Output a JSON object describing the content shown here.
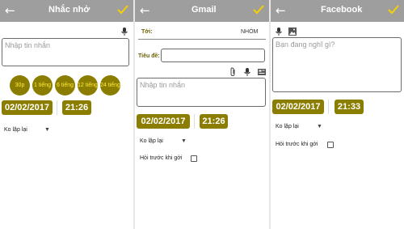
{
  "colors": {
    "appbar": "#9e9e9e",
    "accent": "#8b7d00",
    "chip_text": "#ffeb3b",
    "check": "#f5d000"
  },
  "reminder": {
    "title": "Nhắc nhở",
    "message_placeholder": "Nhập tin nhắn",
    "chips": [
      "30p",
      "1 tiếng",
      "6 tiếng",
      "12 tiếng",
      "24 tiếng"
    ],
    "date": "02/02/2017",
    "time": "21:26",
    "repeat": "Ko lặp lại"
  },
  "gmail": {
    "title": "Gmail",
    "to_label": "Tới:",
    "group_label": "NHÓM",
    "subject_label": "Tiêu đề:",
    "message_placeholder": "Nhập tin nhắn",
    "date": "02/02/2017",
    "time": "21:26",
    "repeat": "Ko lặp lại",
    "ask_label": "Hỏi trước khi gởi"
  },
  "facebook": {
    "title": "Facebook",
    "status_placeholder": "Bạn đang nghĩ gì?",
    "date": "02/02/2017",
    "time": "21:33",
    "repeat": "Ko lặp lại",
    "ask_label": "Hỏi trước khi gởi"
  },
  "icons": [
    "back-arrow-icon",
    "checkmark-icon",
    "mic-icon",
    "image-icon",
    "attachment-icon",
    "contact-card-icon",
    "chevron-down-icon"
  ]
}
